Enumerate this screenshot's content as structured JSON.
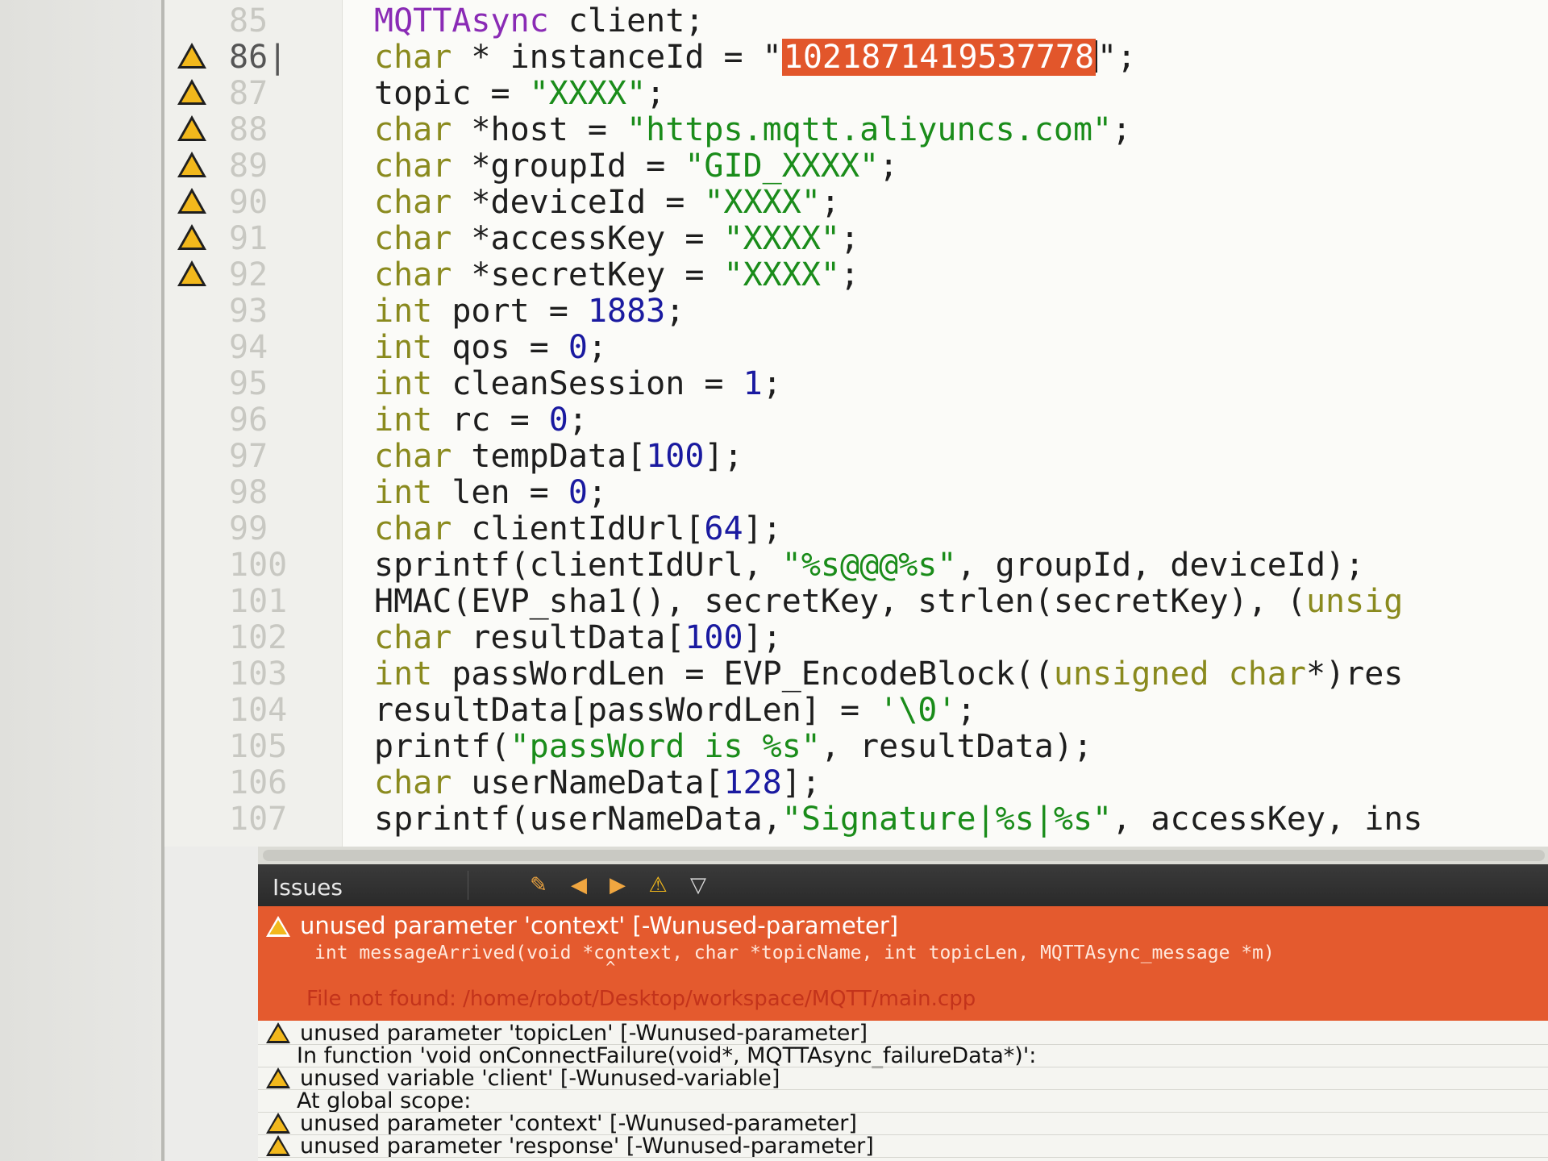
{
  "editor": {
    "current_line": "86|",
    "lines": [
      {
        "num": "85",
        "parts": [
          {
            "t": "ty",
            "v": "MQTTAsync"
          },
          {
            "t": "",
            "v": " client;"
          }
        ]
      },
      {
        "num": "86",
        "parts": [
          {
            "t": "kw",
            "v": "char"
          },
          {
            "t": "",
            "v": " * instanceId = \""
          },
          {
            "t": "sel",
            "v": "1021871419537778"
          },
          {
            "t": "",
            "v": "\";"
          }
        ]
      },
      {
        "num": "87",
        "parts": [
          {
            "t": "",
            "v": "topic = "
          },
          {
            "t": "str",
            "v": "\"XXXX\""
          },
          {
            "t": "",
            "v": ";"
          }
        ]
      },
      {
        "num": "88",
        "parts": [
          {
            "t": "kw",
            "v": "char"
          },
          {
            "t": "",
            "v": " *host = "
          },
          {
            "t": "str",
            "v": "\"https.mqtt.aliyuncs.com\""
          },
          {
            "t": "",
            "v": ";"
          }
        ]
      },
      {
        "num": "89",
        "parts": [
          {
            "t": "kw",
            "v": "char"
          },
          {
            "t": "",
            "v": " *groupId = "
          },
          {
            "t": "str",
            "v": "\"GID_XXXX\""
          },
          {
            "t": "",
            "v": ";"
          }
        ]
      },
      {
        "num": "90",
        "parts": [
          {
            "t": "kw",
            "v": "char"
          },
          {
            "t": "",
            "v": " *deviceId = "
          },
          {
            "t": "str",
            "v": "\"XXXX\""
          },
          {
            "t": "",
            "v": ";"
          }
        ]
      },
      {
        "num": "91",
        "parts": [
          {
            "t": "kw",
            "v": "char"
          },
          {
            "t": "",
            "v": " *accessKey = "
          },
          {
            "t": "str",
            "v": "\"XXXX\""
          },
          {
            "t": "",
            "v": ";"
          }
        ]
      },
      {
        "num": "92",
        "parts": [
          {
            "t": "kw",
            "v": "char"
          },
          {
            "t": "",
            "v": " *secretKey = "
          },
          {
            "t": "str",
            "v": "\"XXXX\""
          },
          {
            "t": "",
            "v": ";"
          }
        ]
      },
      {
        "num": "93",
        "parts": [
          {
            "t": "kw",
            "v": "int"
          },
          {
            "t": "",
            "v": " port = "
          },
          {
            "t": "num",
            "v": "1883"
          },
          {
            "t": "",
            "v": ";"
          }
        ]
      },
      {
        "num": "94",
        "parts": [
          {
            "t": "kw",
            "v": "int"
          },
          {
            "t": "",
            "v": " qos = "
          },
          {
            "t": "num",
            "v": "0"
          },
          {
            "t": "",
            "v": ";"
          }
        ]
      },
      {
        "num": "95",
        "parts": [
          {
            "t": "kw",
            "v": "int"
          },
          {
            "t": "",
            "v": " cleanSession = "
          },
          {
            "t": "num",
            "v": "1"
          },
          {
            "t": "",
            "v": ";"
          }
        ]
      },
      {
        "num": "96",
        "parts": [
          {
            "t": "kw",
            "v": "int"
          },
          {
            "t": "",
            "v": " rc = "
          },
          {
            "t": "num",
            "v": "0"
          },
          {
            "t": "",
            "v": ";"
          }
        ]
      },
      {
        "num": "97",
        "parts": [
          {
            "t": "kw",
            "v": "char"
          },
          {
            "t": "",
            "v": " tempData["
          },
          {
            "t": "num",
            "v": "100"
          },
          {
            "t": "",
            "v": "];"
          }
        ]
      },
      {
        "num": "98",
        "parts": [
          {
            "t": "kw",
            "v": "int"
          },
          {
            "t": "",
            "v": " len = "
          },
          {
            "t": "num",
            "v": "0"
          },
          {
            "t": "",
            "v": ";"
          }
        ]
      },
      {
        "num": "99",
        "parts": [
          {
            "t": "kw",
            "v": "char"
          },
          {
            "t": "",
            "v": " clientIdUrl["
          },
          {
            "t": "num",
            "v": "64"
          },
          {
            "t": "",
            "v": "];"
          }
        ]
      },
      {
        "num": "100",
        "parts": [
          {
            "t": "",
            "v": "sprintf(clientIdUrl, "
          },
          {
            "t": "str",
            "v": "\"%s@@@%s\""
          },
          {
            "t": "",
            "v": ", groupId, deviceId);"
          }
        ]
      },
      {
        "num": "101",
        "parts": [
          {
            "t": "",
            "v": "HMAC(EVP_sha1(), secretKey, strlen(secretKey), ("
          },
          {
            "t": "kw",
            "v": "unsig"
          }
        ]
      },
      {
        "num": "102",
        "parts": [
          {
            "t": "kw",
            "v": "char"
          },
          {
            "t": "",
            "v": " resultData["
          },
          {
            "t": "num",
            "v": "100"
          },
          {
            "t": "",
            "v": "];"
          }
        ]
      },
      {
        "num": "103",
        "parts": [
          {
            "t": "kw",
            "v": "int"
          },
          {
            "t": "",
            "v": " passWordLen = EVP_EncodeBlock(("
          },
          {
            "t": "kw",
            "v": "unsigned char"
          },
          {
            "t": "",
            "v": "*)res"
          }
        ]
      },
      {
        "num": "104",
        "parts": [
          {
            "t": "",
            "v": "resultData[passWordLen] = "
          },
          {
            "t": "str",
            "v": "'\\0'"
          },
          {
            "t": "",
            "v": ";"
          }
        ]
      },
      {
        "num": "105",
        "parts": [
          {
            "t": "",
            "v": "printf("
          },
          {
            "t": "str",
            "v": "\"passWord is %s\""
          },
          {
            "t": "",
            "v": ", resultData);"
          }
        ]
      },
      {
        "num": "106",
        "parts": [
          {
            "t": "kw",
            "v": "char"
          },
          {
            "t": "",
            "v": " userNameData["
          },
          {
            "t": "num",
            "v": "128"
          },
          {
            "t": "",
            "v": "];"
          }
        ]
      },
      {
        "num": "107",
        "parts": [
          {
            "t": "",
            "v": "sprintf(userNameData,"
          },
          {
            "t": "str",
            "v": "\"Signature|%s|%s\""
          },
          {
            "t": "",
            "v": ", accessKey, ins"
          }
        ]
      }
    ],
    "warning_lines": [
      "86",
      "87",
      "88",
      "89",
      "90",
      "91",
      "92"
    ]
  },
  "issues": {
    "title": "Issues",
    "toolbar_icons": [
      "clean-issues-icon",
      "prev-issue-icon",
      "next-issue-icon",
      "warnings-filter-icon",
      "filter-icon"
    ],
    "selected": {
      "message": "unused parameter 'context' [-Wunused-parameter]",
      "code": "int messageArrived(void *context, char *topicName, int topicLen, MQTTAsync_message *m)",
      "caret_line": "                              ^",
      "file_note": "File not found: /home/robot/Desktop/workspace/MQTT/main.cpp"
    },
    "rows": [
      {
        "kind": "warning",
        "message": "unused parameter 'topicLen' [-Wunused-parameter]"
      },
      {
        "kind": "context",
        "message": "In function 'void onConnectFailure(void*, MQTTAsync_failureData*)':"
      },
      {
        "kind": "warning",
        "message": "unused variable 'client' [-Wunused-variable]"
      },
      {
        "kind": "context",
        "message": "At global scope:"
      },
      {
        "kind": "warning",
        "message": "unused parameter 'context' [-Wunused-parameter]"
      },
      {
        "kind": "warning",
        "message": "unused parameter 'response' [-Wunused-parameter]"
      }
    ]
  },
  "colors": {
    "selection": "#e2562b",
    "selected_issue_bg": "#e45a2e",
    "keyword": "#8a8a1e",
    "type": "#8a2bb5",
    "string": "#1a8c1a",
    "number": "#1a1aa0",
    "warning": "#f2b81c"
  }
}
